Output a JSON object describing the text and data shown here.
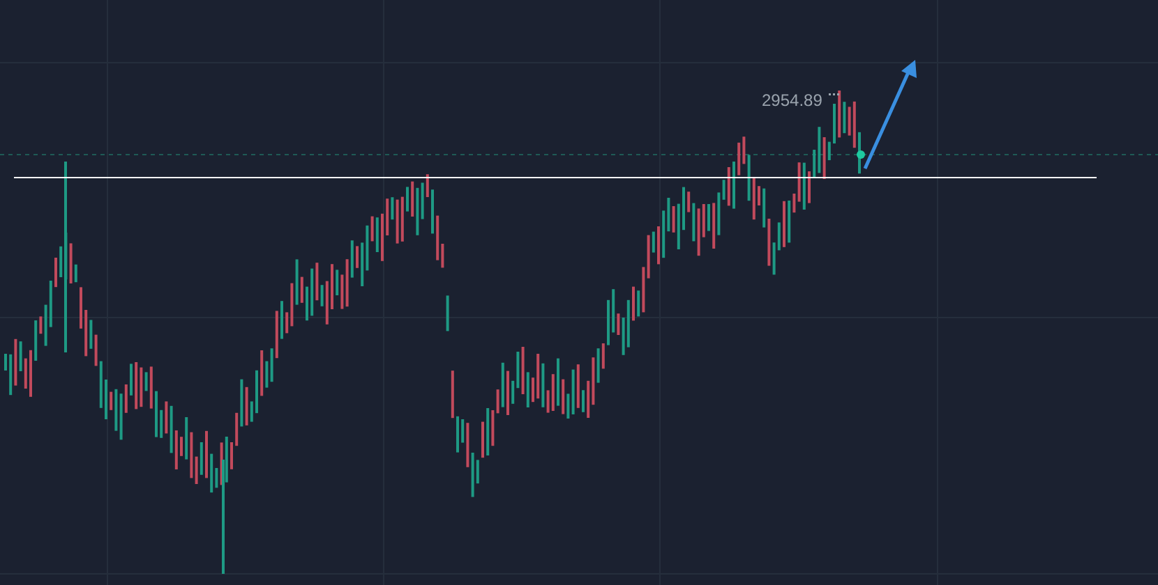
{
  "chart": {
    "price_label": "2954.89"
  }
}
